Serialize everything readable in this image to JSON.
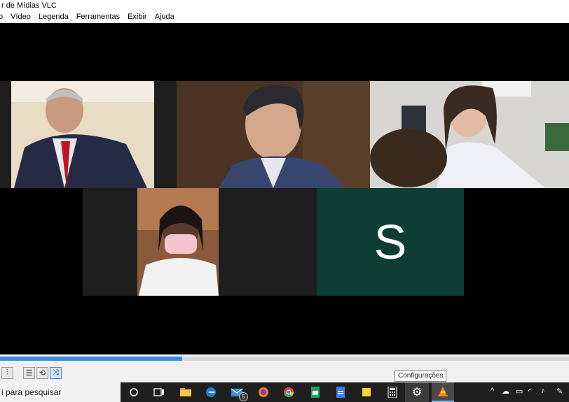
{
  "window": {
    "title": "r de Mídias VLC"
  },
  "menu": [
    "o",
    "Vídeo",
    "Legenda",
    "Ferramentas",
    "Exibir",
    "Ajuda"
  ],
  "participants": {
    "initial": "S"
  },
  "seek": {
    "progress": 0.32
  },
  "tooltip": "Configurações",
  "taskbar": {
    "search_placeholder": "i para pesquisar",
    "mail_badge": "5"
  },
  "colors": {
    "accent": "#3c8ddb",
    "tile_avatar": "#0e3d33",
    "taskbar": "#1f1f1f"
  }
}
